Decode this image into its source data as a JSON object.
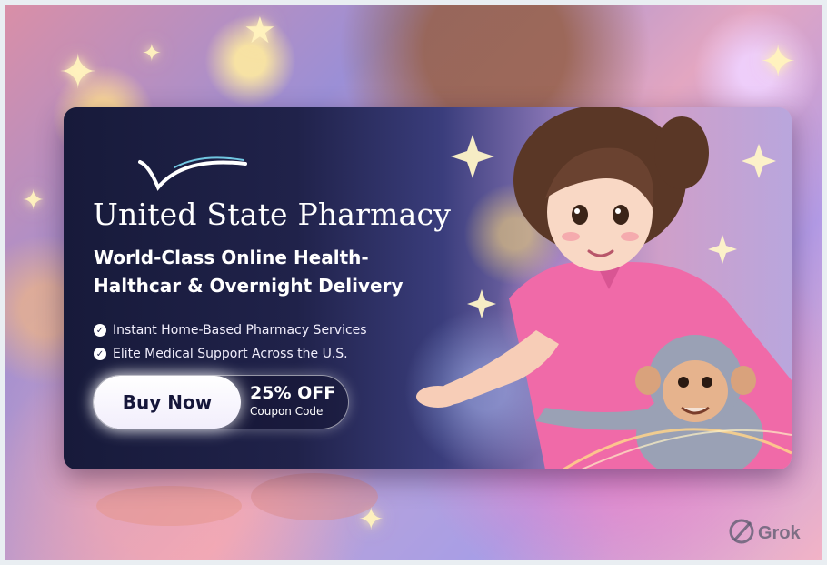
{
  "colors": {
    "card_dark": "#171a3a",
    "accent_violet": "#8c78b8",
    "shirt_pink": "#f06aa8",
    "button_text": "#15163a",
    "text_white": "#ffffff"
  },
  "banner": {
    "brand": "United State Pharmacy",
    "logo_icon": "checkmark-swoosh-icon",
    "headline_line1": "World-Class Online Health-",
    "headline_line2": "Halthcar & Overnight Delivery",
    "features": [
      {
        "icon": "check-circle-icon",
        "text": "Instant Home-Based Pharmacy Services"
      },
      {
        "icon": "check-circle-icon",
        "text": "Elite Medical Support Across the U.S."
      }
    ],
    "cta": {
      "button_label": "Buy Now",
      "coupon_title": "25% OFF",
      "coupon_subtitle": "Coupon Code"
    }
  },
  "watermark": {
    "icon": "grok-logo-icon",
    "text": "Grok"
  }
}
